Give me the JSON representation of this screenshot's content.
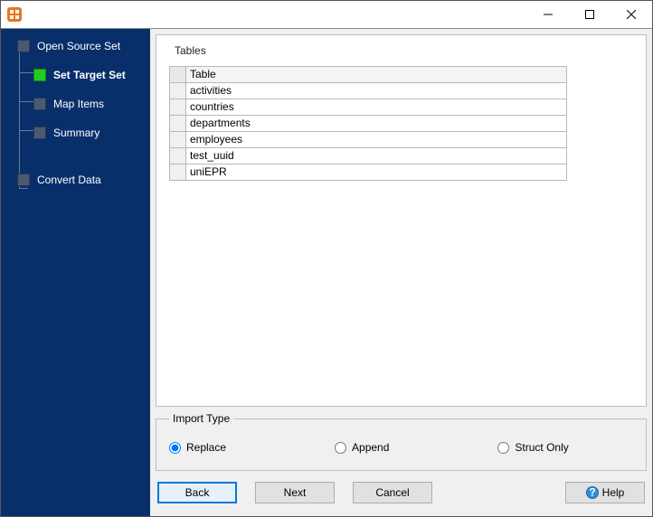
{
  "titlebar": {
    "title": ""
  },
  "sidebar": {
    "steps": [
      {
        "label": "Open Source Set"
      },
      {
        "label": "Set Target Set"
      },
      {
        "label": "Map Items"
      },
      {
        "label": "Summary"
      },
      {
        "label": "Convert Data"
      }
    ]
  },
  "tables_panel": {
    "title": "Tables",
    "header": "Table",
    "rows": [
      "activities",
      "countries",
      "departments",
      "employees",
      "test_uuid",
      "uniEPR"
    ]
  },
  "import_type": {
    "legend": "Import Type",
    "options": {
      "replace": "Replace",
      "append": "Append",
      "struct": "Struct Only"
    },
    "selected": "replace"
  },
  "buttons": {
    "back": "Back",
    "next": "Next",
    "cancel": "Cancel",
    "help": "Help"
  }
}
